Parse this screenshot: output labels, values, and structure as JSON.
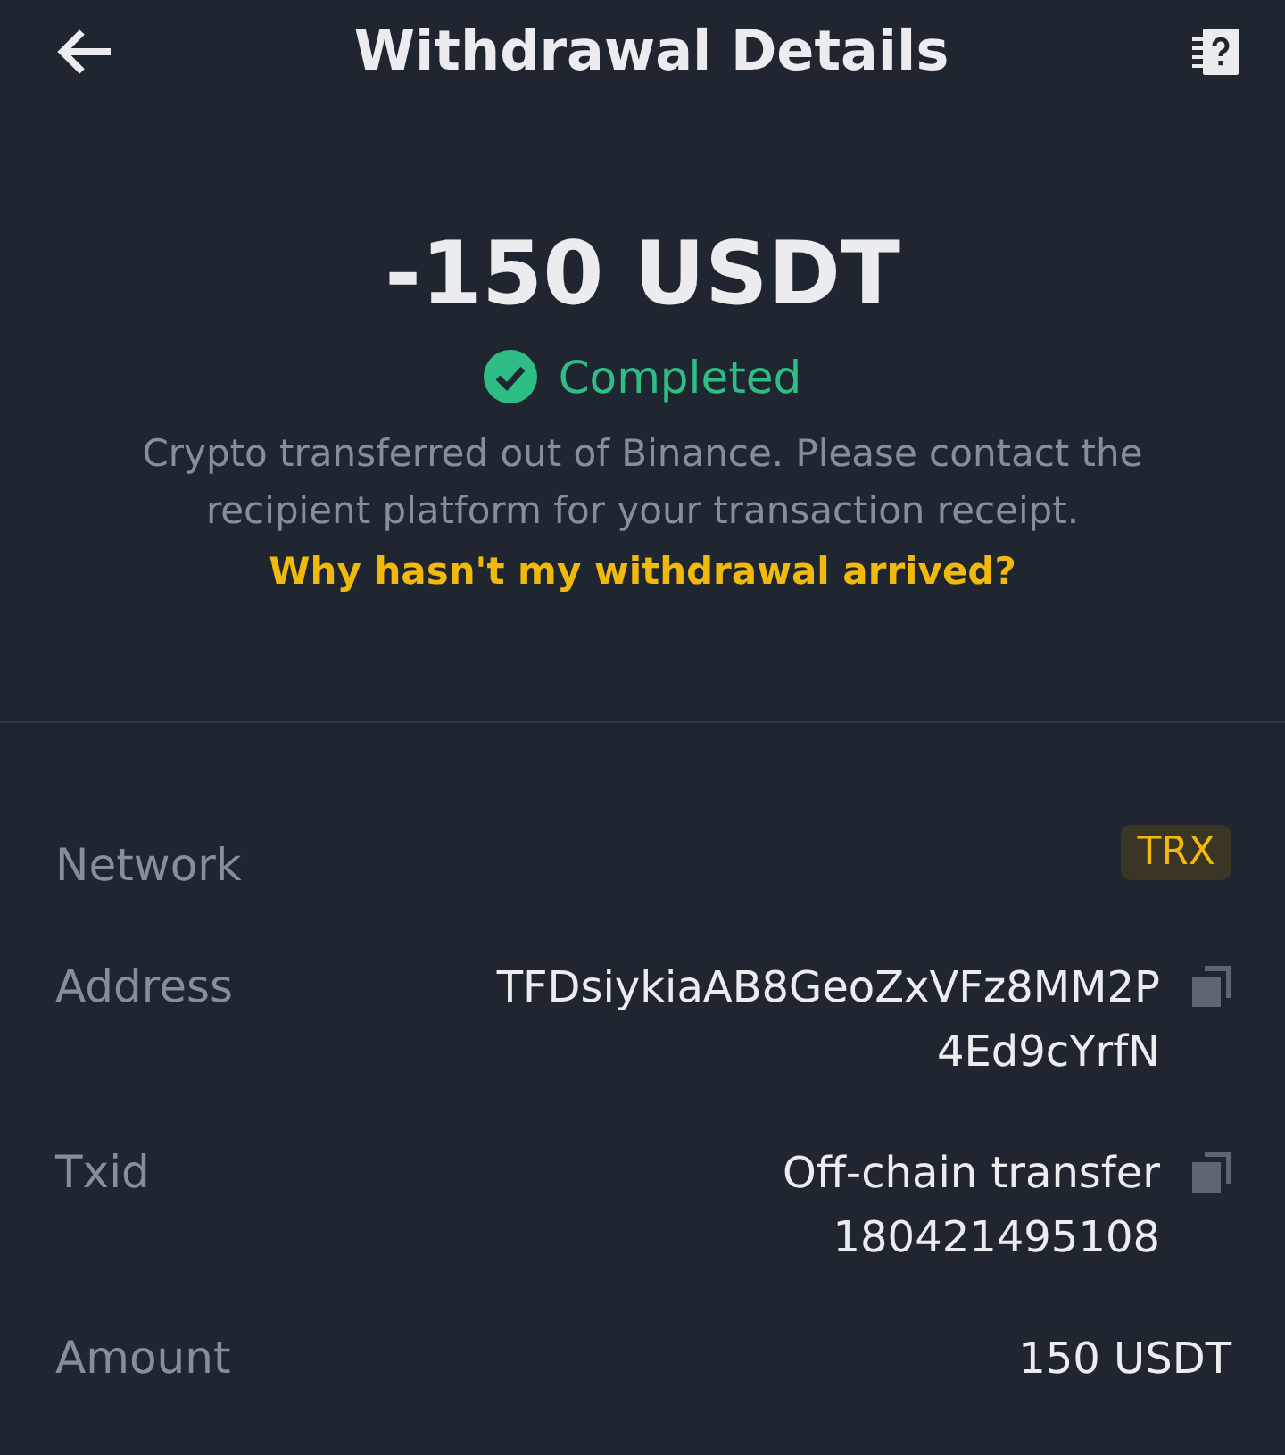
{
  "header": {
    "title": "Withdrawal Details"
  },
  "amount": "-150 USDT",
  "status": {
    "kind": "completed",
    "label": "Completed"
  },
  "description": "Crypto transferred out of Binance. Please contact the recipient platform for your transaction receipt.",
  "help_link": "Why hasn't my withdrawal arrived?",
  "details": [
    {
      "kind": "tag",
      "label": "Network",
      "lines": [
        "TRX"
      ]
    },
    {
      "kind": "copyable",
      "label": "Address",
      "lines": [
        "TFDsiykiaAB8GeoZxVFz8MM2P",
        "4Ed9cYrfN"
      ]
    },
    {
      "kind": "copyable",
      "label": "Txid",
      "lines": [
        "Off-chain transfer",
        "180421495108"
      ]
    },
    {
      "kind": "text",
      "label": "Amount",
      "lines": [
        "150 USDT"
      ]
    }
  ]
}
